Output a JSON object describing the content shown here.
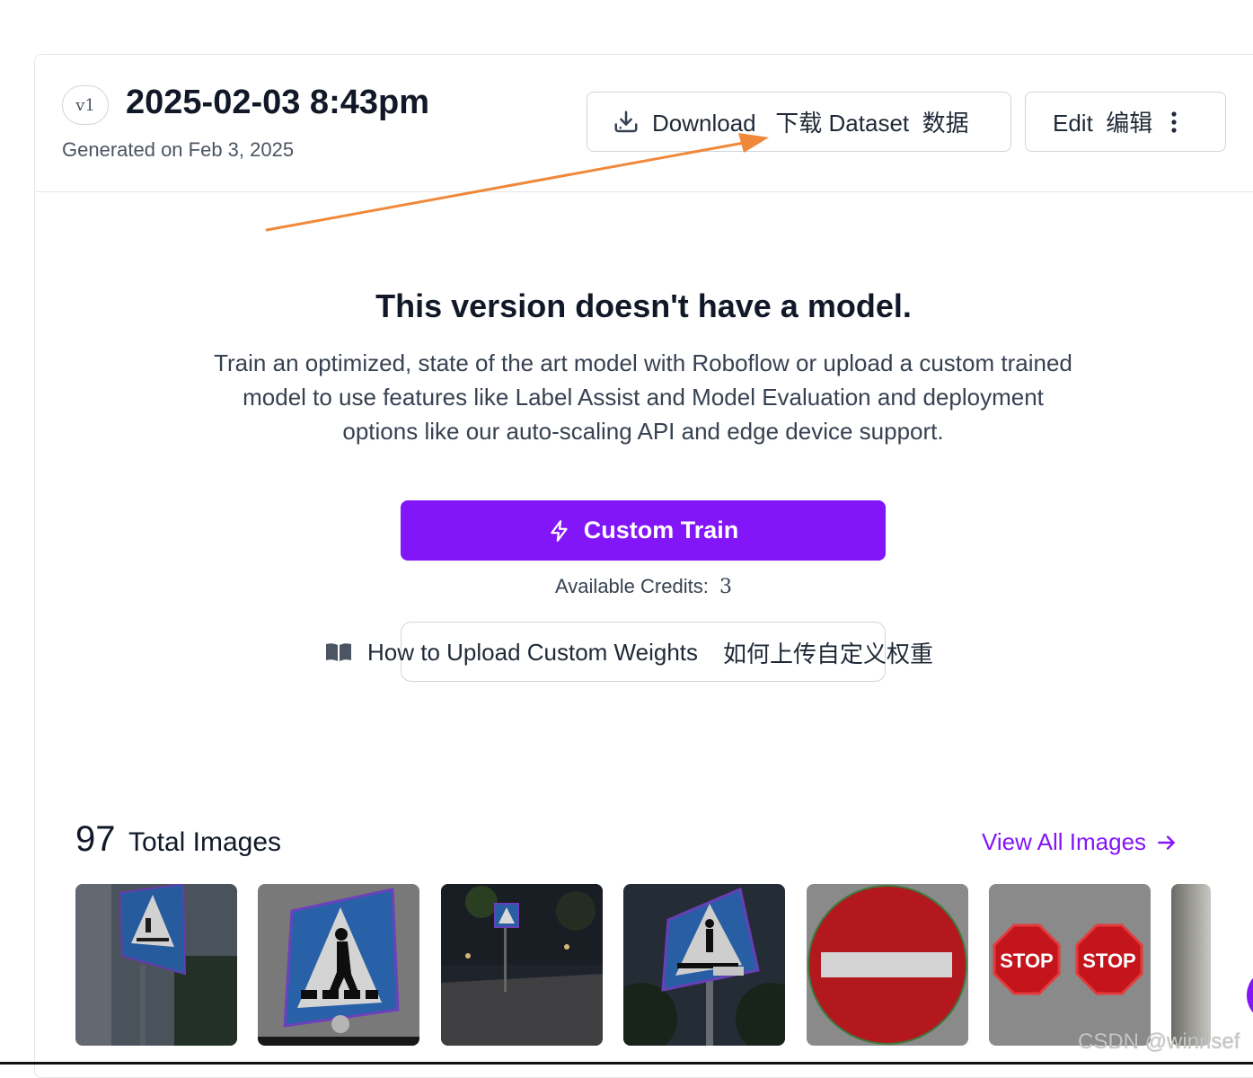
{
  "version": {
    "badge": "v1",
    "title": "2025-02-03 8:43pm",
    "generated": "Generated on Feb 3, 2025"
  },
  "toolbar": {
    "download_label": "Download   下载 Dataset  数据",
    "download_icon": "download-icon",
    "edit_label": "Edit  编辑",
    "more_icon": "more-vertical-icon"
  },
  "model": {
    "title": "This version doesn't have a model.",
    "description": "Train an optimized, state of the art model with Roboflow or upload a custom trained model to use features like Label Assist and Model Evaluation and deployment options like our auto-scaling API and edge device support.",
    "train_label": "Custom Train",
    "train_icon": "lightning-icon",
    "credits_label": "Available Credits:",
    "credits_value": "3",
    "upload_label": "How to Upload Custom Weights",
    "upload_label_cn": "如何上传自定义权重",
    "upload_icon": "book-icon"
  },
  "images": {
    "count": "97",
    "label": "Total Images",
    "view_all": "View All Images",
    "view_all_icon": "arrow-right-icon",
    "thumbnails": [
      {
        "subject": "crosswalk sign on building"
      },
      {
        "subject": "crosswalk sign close-up"
      },
      {
        "subject": "crosswalk sign at night street"
      },
      {
        "subject": "crosswalk sign against sky"
      },
      {
        "subject": "no entry sign",
        "text": ""
      },
      {
        "subject": "two stop signs",
        "text": "STOP"
      },
      {
        "subject": "partial image"
      }
    ]
  },
  "watermark": "CSDN @winrisef",
  "colors": {
    "accent": "#8315f9",
    "arrow": "#f0883a",
    "border": "#e5e7eb"
  }
}
